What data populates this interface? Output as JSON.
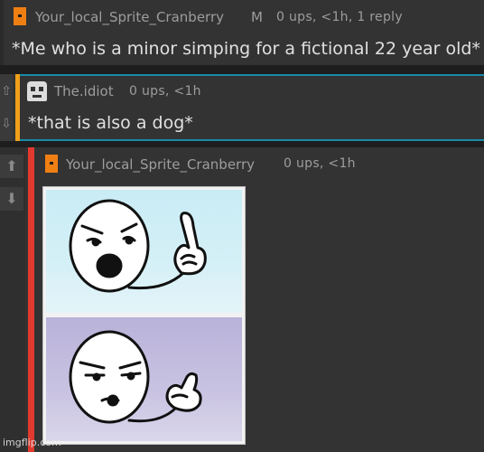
{
  "comments": [
    {
      "author": "Your_local_Sprite_Cranberry",
      "badge": "M",
      "meta": "0 ups, <1h, 1 reply",
      "text": "*Me who is a minor simping for a fictional 22 year old*",
      "avatar": "orange-square-icon"
    },
    {
      "author": "The.idiot",
      "meta": "0 ups, <1h",
      "text": "*that is also a dog*",
      "avatar": "skull-pixel-icon",
      "upvote": "⇧",
      "downvote": "⇩"
    },
    {
      "author": "Your_local_Sprite_Cranberry",
      "meta": "0 ups, <1h",
      "avatar": "orange-square-icon",
      "upvote": "⬆",
      "downvote": "⬇",
      "image": "wait-a-minute-stickman-meme"
    }
  ],
  "watermark": "imgflip.com",
  "colors": {
    "background": "#1e1e1e",
    "comment_bg": "#333333",
    "reply_stripe": "#f0a018",
    "highlight": "#1a8aa8",
    "thread_stripe": "#e23a2f",
    "avatar": "#f07f13"
  }
}
